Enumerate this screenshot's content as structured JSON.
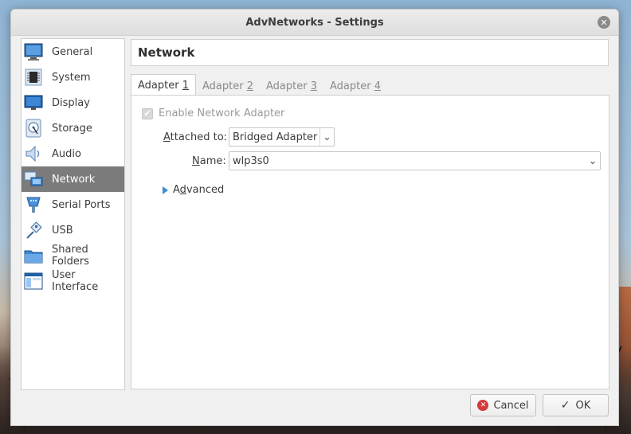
{
  "window": {
    "title": "AdvNetworks - Settings"
  },
  "sidebar": {
    "items": [
      {
        "label": "General",
        "icon": "general-icon"
      },
      {
        "label": "System",
        "icon": "system-chip-icon"
      },
      {
        "label": "Display",
        "icon": "display-monitor-icon"
      },
      {
        "label": "Storage",
        "icon": "storage-disk-icon"
      },
      {
        "label": "Audio",
        "icon": "audio-speaker-icon"
      },
      {
        "label": "Network",
        "icon": "network-icon",
        "selected": true
      },
      {
        "label": "Serial Ports",
        "icon": "serial-port-icon"
      },
      {
        "label": "USB",
        "icon": "usb-icon"
      },
      {
        "label": "Shared Folders",
        "icon": "shared-folder-icon"
      },
      {
        "label": "User Interface",
        "icon": "user-interface-icon"
      }
    ]
  },
  "header": {
    "title": "Network"
  },
  "tabs": [
    {
      "pre": "Adapter ",
      "mnemonic": "1",
      "active": true
    },
    {
      "pre": "Adapter ",
      "mnemonic": "2",
      "active": false
    },
    {
      "pre": "Adapter ",
      "mnemonic": "3",
      "active": false
    },
    {
      "pre": "Adapter ",
      "mnemonic": "4",
      "active": false
    }
  ],
  "adapter": {
    "enable_label": "Enable Network Adapter",
    "enable_checked": true,
    "attached_label_mnemonic": "A",
    "attached_label_rest": "ttached to:",
    "attached_value": "Bridged Adapter",
    "name_label_mnemonic": "N",
    "name_label_rest": "ame:",
    "name_value": "wlp3s0",
    "advanced_pre": "A",
    "advanced_mnemonic": "d",
    "advanced_rest": "vanced"
  },
  "buttons": {
    "cancel": "Cancel",
    "ok": "OK"
  },
  "colors": {
    "selected_bg": "#7b7b7b",
    "accent": "#3a8fd8",
    "cancel_red": "#d23c3c"
  }
}
